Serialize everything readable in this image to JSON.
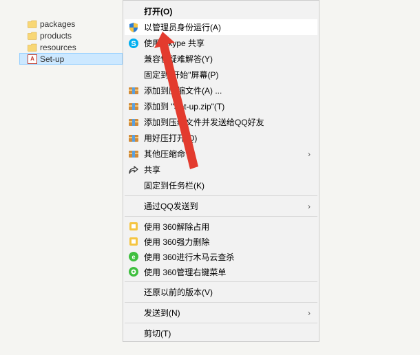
{
  "tree": {
    "items": [
      {
        "name": "packages",
        "type": "folder"
      },
      {
        "name": "products",
        "type": "folder"
      },
      {
        "name": "resources",
        "type": "folder"
      },
      {
        "name": "Set-up",
        "type": "app",
        "selected": true
      }
    ]
  },
  "menu": {
    "open": "打开(O)",
    "run_admin": "以管理员身份运行(A)",
    "skype_share": "使用 Skype 共享",
    "compat": "兼容性疑难解答(Y)",
    "pin_start": "固定到\"开始\"屏幕(P)",
    "add_archive": "添加到压缩文件(A) ...",
    "add_zip": "添加到 \"Set-up.zip\"(T)",
    "send_qq": "添加到压缩文件并发送给QQ好友",
    "haozip_open": "用好压打开(Q)",
    "other_archive": "其他压缩命令",
    "share": "共享",
    "pin_taskbar": "固定到任务栏(K)",
    "qq_send": "通过QQ发送到",
    "360_unlock": "使用 360解除占用",
    "360_force_del": "使用 360强力删除",
    "360_trojan": "使用 360进行木马云查杀",
    "360_manage_menu": "使用 360管理右键菜单",
    "restore_prev": "还原以前的版本(V)",
    "send_to": "发送到(N)",
    "cut": "剪切(T)"
  },
  "icons": {
    "shield": "shield-icon",
    "skype": "skype-icon",
    "archive": "archive-icon",
    "share": "share-icon",
    "360yellow": "360-yellow-icon",
    "360greenE": "360-green-e-icon",
    "360green": "360-green-icon",
    "chevron": "›"
  }
}
